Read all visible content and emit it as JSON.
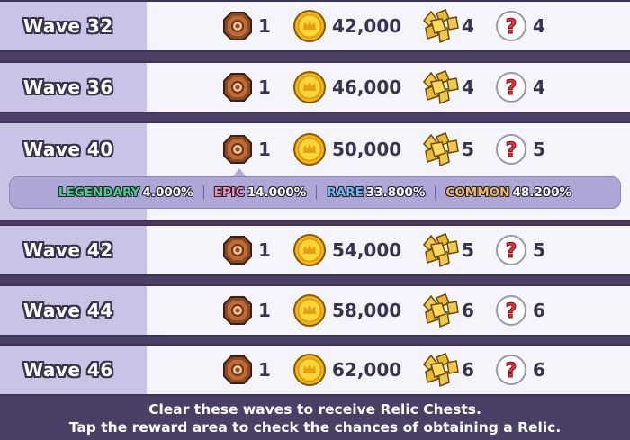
{
  "waves": [
    {
      "label": "Wave 32",
      "chests": "1",
      "coins": "42,000",
      "relics": "4",
      "unknown": "4"
    },
    {
      "label": "Wave 36",
      "chests": "1",
      "coins": "46,000",
      "relics": "4",
      "unknown": "4"
    },
    {
      "label": "Wave 40",
      "chests": "1",
      "coins": "50,000",
      "relics": "5",
      "unknown": "5"
    },
    {
      "label": "Wave 42",
      "chests": "1",
      "coins": "54,000",
      "relics": "5",
      "unknown": "5"
    },
    {
      "label": "Wave 44",
      "chests": "1",
      "coins": "58,000",
      "relics": "6",
      "unknown": "6"
    },
    {
      "label": "Wave 46",
      "chests": "1",
      "coins": "62,000",
      "relics": "6",
      "unknown": "6"
    }
  ],
  "chances": [
    {
      "name": "LEGENDARY",
      "value": "4.000%",
      "color": "#3ecf8e"
    },
    {
      "name": "EPIC",
      "value": "14.000%",
      "color": "#f38bb7"
    },
    {
      "name": "RARE",
      "value": "33.800%",
      "color": "#6fb6f2"
    },
    {
      "name": "COMMON",
      "value": "48.200%",
      "color": "#f0b96a"
    }
  ],
  "icons": {
    "chest": "relic-chest-icon",
    "coin": "coin-icon",
    "relic": "relic-pieces-icon",
    "unknown": "question-mark-icon"
  },
  "footer": {
    "line1": "Clear these waves to receive Relic Chests.",
    "line2": "Tap the reward area to check the chances of obtaining a Relic."
  }
}
